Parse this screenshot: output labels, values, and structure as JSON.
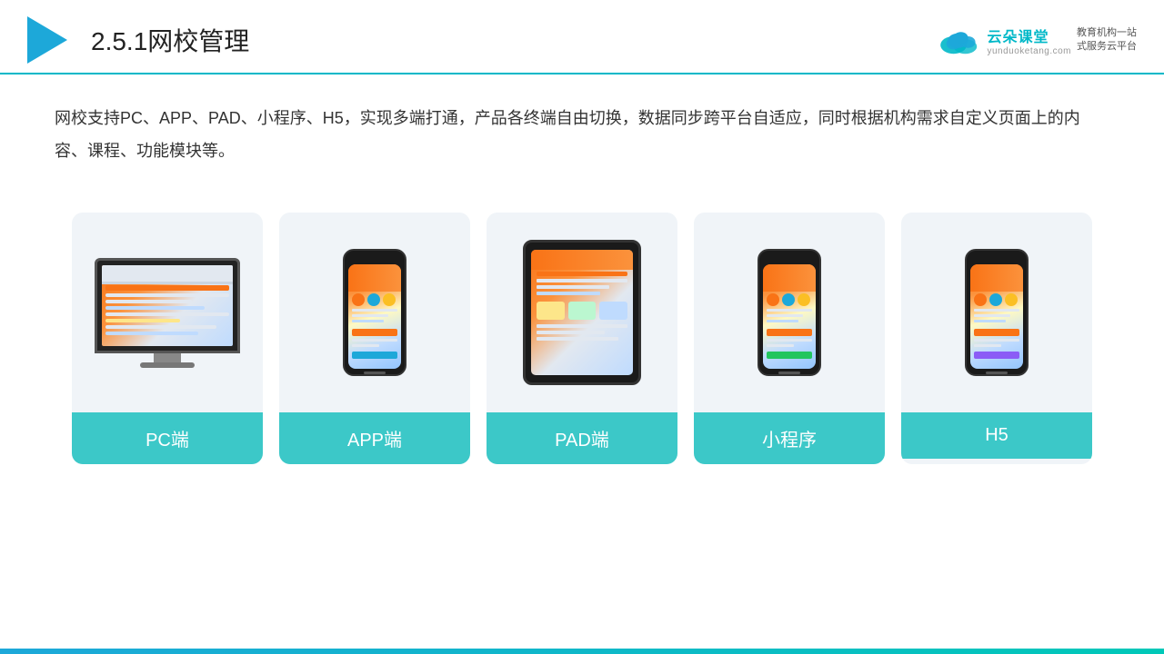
{
  "header": {
    "section_number": "2.5.1",
    "title": "网校管理",
    "brand_cn": "云朵课堂",
    "brand_en": "yunduoketang.com",
    "brand_tagline_line1": "教育机构一站",
    "brand_tagline_line2": "式服务云平台"
  },
  "description": {
    "text": "网校支持PC、APP、PAD、小程序、H5，实现多端打通，产品各终端自由切换，数据同步跨平台自适应，同时根据机构需求自定义页面上的内容、课程、功能模块等。"
  },
  "cards": [
    {
      "id": "pc",
      "label": "PC端"
    },
    {
      "id": "app",
      "label": "APP端"
    },
    {
      "id": "pad",
      "label": "PAD端"
    },
    {
      "id": "miniapp",
      "label": "小程序"
    },
    {
      "id": "h5",
      "label": "H5"
    }
  ]
}
